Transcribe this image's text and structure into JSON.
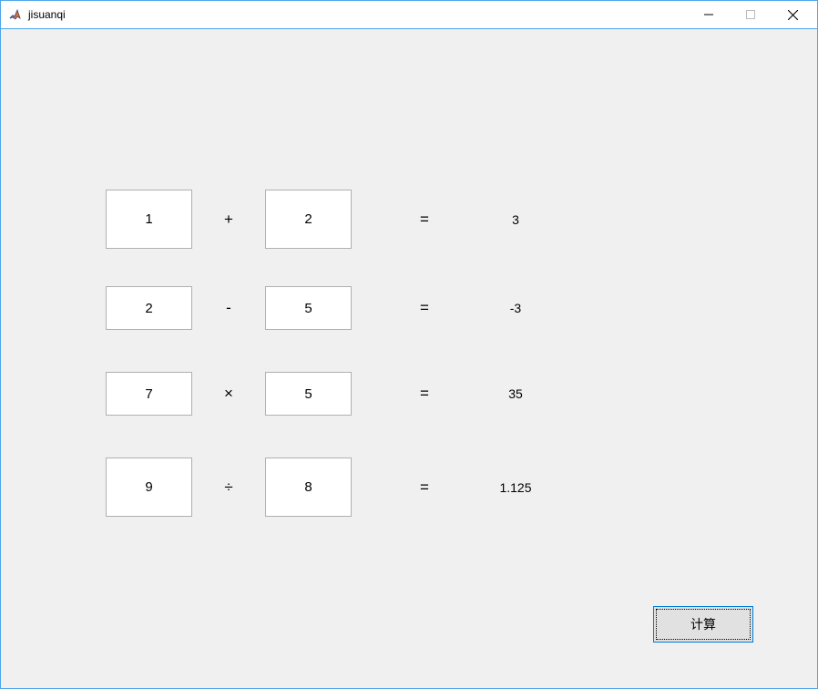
{
  "window": {
    "title": "jisuanqi"
  },
  "rows": [
    {
      "input1": "1",
      "operator": "+",
      "input2": "2",
      "equals": "=",
      "result": "3"
    },
    {
      "input1": "2",
      "operator": "-",
      "input2": "5",
      "equals": "=",
      "result": "-3"
    },
    {
      "input1": "7",
      "operator": "×",
      "input2": "5",
      "equals": "=",
      "result": "35"
    },
    {
      "input1": "9",
      "operator": "÷",
      "input2": "8",
      "equals": "=",
      "result": "1.125"
    }
  ],
  "button": {
    "calculate": "计算"
  }
}
